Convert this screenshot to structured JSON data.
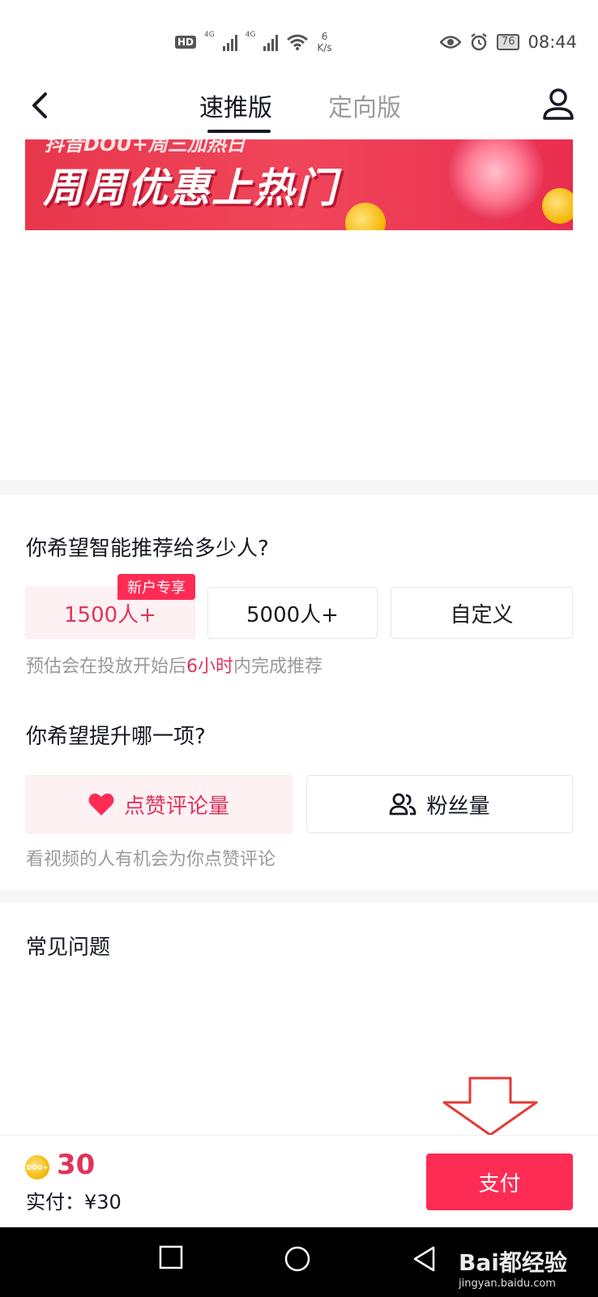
{
  "status_bar": {
    "hd": "HD",
    "net1": "4G",
    "net2": "4G",
    "speed_value": "6",
    "speed_unit": "K/s",
    "battery": "76",
    "time": "08:44"
  },
  "nav": {
    "tabs": [
      {
        "label": "速推版",
        "active": true
      },
      {
        "label": "定向版",
        "active": false
      }
    ]
  },
  "banner": {
    "top_text": "抖音DOU+周三加热日",
    "main_text": "周周优惠上热门"
  },
  "audience": {
    "question": "你希望智能推荐给多少人?",
    "badge": "新户专享",
    "options": [
      {
        "label": "1500人+",
        "selected": true
      },
      {
        "label": "5000人+",
        "selected": false
      },
      {
        "label": "自定义",
        "selected": false
      }
    ],
    "hint_before": "预估会在投放开始后",
    "hint_highlight": "6小时",
    "hint_after": "内完成推荐"
  },
  "goal": {
    "question": "你希望提升哪一项?",
    "options": [
      {
        "label": "点赞评论量",
        "icon": "heart-icon",
        "selected": true
      },
      {
        "label": "粉丝量",
        "icon": "users-icon",
        "selected": false
      }
    ],
    "hint": "看视频的人有机会为你点赞评论"
  },
  "faq": {
    "title": "常见问题"
  },
  "pay": {
    "coin_label": "DOU+",
    "amount": "30",
    "actual": "实付：¥30",
    "button": "支付"
  },
  "watermark": {
    "brand": "Bai都经验",
    "url": "jingyan.baidu.com"
  },
  "colors": {
    "accent": "#fe2c55",
    "accent_text": "#e0345a",
    "selected_bg": "#fef1f3",
    "hint": "#9a9a9a"
  }
}
